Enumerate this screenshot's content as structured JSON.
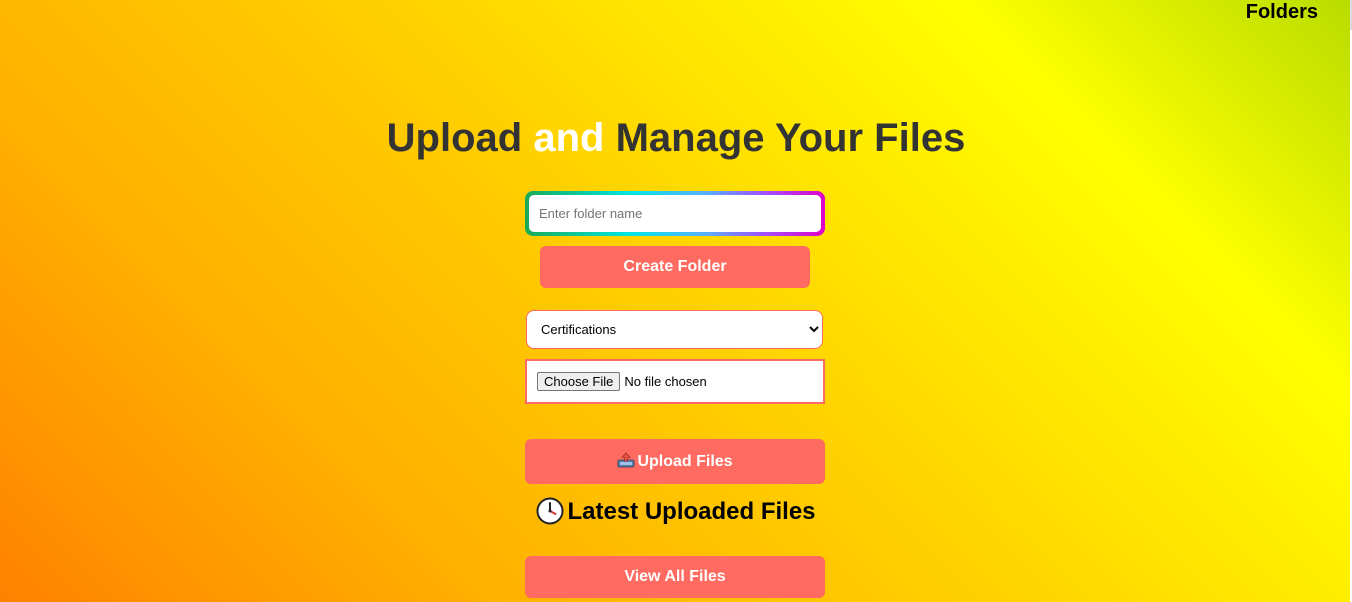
{
  "nav": {
    "folders_link": "Folders"
  },
  "header": {
    "title_before": "Upload ",
    "title_highlight": "and",
    "title_after": " Manage Your Files",
    "highlight_color": "#ffffff"
  },
  "create_folder": {
    "input_placeholder": "Enter folder name",
    "input_value": "",
    "button_label": "Create Folder"
  },
  "upload": {
    "folder_select_value": "Certifications",
    "file_button_label": "Choose File",
    "file_status": "No file chosen",
    "button_icon": "upload-tray-icon",
    "button_label": "Upload Files"
  },
  "latest": {
    "icon": "clock-icon",
    "heading": "Latest Uploaded Files",
    "view_all_label": "View All Files"
  },
  "colors": {
    "accent_button": "#ff6b60",
    "title_text": "#333333"
  }
}
